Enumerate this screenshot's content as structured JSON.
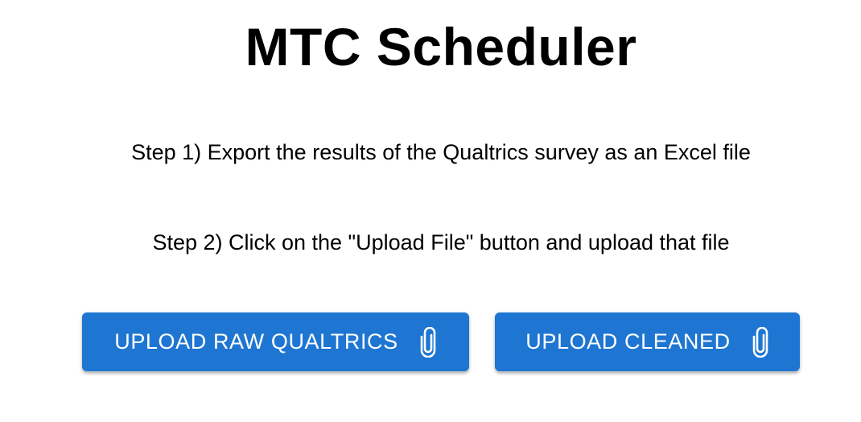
{
  "header": {
    "title": "MTC Scheduler"
  },
  "instructions": {
    "step1": "Step 1) Export the results of the Qualtrics survey as an Excel file",
    "step2": "Step 2) Click on the \"Upload File\" button and upload that file"
  },
  "actions": {
    "upload_raw_label": "UPLOAD RAW QUALTRICS",
    "upload_cleaned_label": "UPLOAD CLEANED",
    "icon": "paperclip-icon"
  },
  "colors": {
    "button_bg": "#1e76d2",
    "button_text": "#ffffff"
  }
}
